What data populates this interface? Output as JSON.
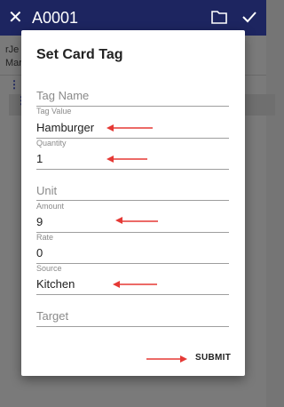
{
  "app": {
    "title": "A0001",
    "bg_line1": "rJe",
    "bg_line2": "Mar"
  },
  "dialog": {
    "title": "Set Card Tag",
    "fields": [
      {
        "label": "",
        "placeholder": "Tag Name",
        "value": ""
      },
      {
        "label": "Tag Value",
        "placeholder": "",
        "value": "Hamburger"
      },
      {
        "label": "Quantity",
        "placeholder": "",
        "value": "1"
      },
      {
        "label": "",
        "placeholder": "Unit",
        "value": ""
      },
      {
        "label": "Amount",
        "placeholder": "",
        "value": "9"
      },
      {
        "label": "Rate",
        "placeholder": "",
        "value": "0"
      },
      {
        "label": "Source",
        "placeholder": "",
        "value": "Kitchen"
      },
      {
        "label": "",
        "placeholder": "Target",
        "value": ""
      }
    ],
    "submit_label": "SUBMIT"
  },
  "colors": {
    "appbar": "#1d2560",
    "annotation_arrow": "#e53935"
  }
}
